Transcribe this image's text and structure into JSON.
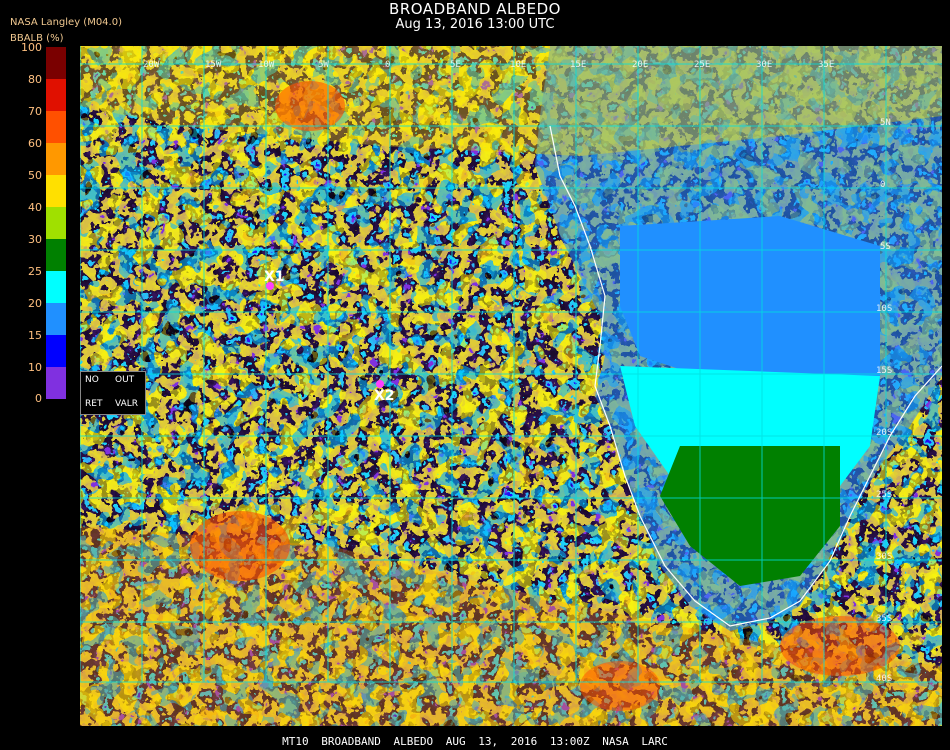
{
  "header": {
    "title": "BROADBAND ALBEDO",
    "subtitle": "Aug 13, 2016 13:00 UTC",
    "brand": "NASA Langley (M04.0)",
    "unit": "BBALB (%)"
  },
  "colorbar": {
    "stops": [
      {
        "label": "100",
        "color": "#7a0000"
      },
      {
        "label": "80",
        "color": "#e01000"
      },
      {
        "label": "70",
        "color": "#ff5000"
      },
      {
        "label": "60",
        "color": "#ff9800"
      },
      {
        "label": "50",
        "color": "#ffe000"
      },
      {
        "label": "40",
        "color": "#a0e000"
      },
      {
        "label": "30",
        "color": "#008000"
      },
      {
        "label": "25",
        "color": "#00ffff"
      },
      {
        "label": "20",
        "color": "#2090ff"
      },
      {
        "label": "15",
        "color": "#0000ff"
      },
      {
        "label": "10",
        "color": "#8030e0"
      },
      {
        "label": "0",
        "color": ""
      }
    ]
  },
  "legend_box": {
    "no": "NO",
    "out": "OUT",
    "ret": "RET",
    "valr": "VALR"
  },
  "markers": {
    "x1": "X1",
    "x2": "X2"
  },
  "grid_labels": {
    "top": [
      "20W",
      "15W",
      "10W",
      "5W",
      "0",
      "5E",
      "10E",
      "15E",
      "20E",
      "25E",
      "30E",
      "35E"
    ],
    "right": [
      "5N",
      "0",
      "5S",
      "10S",
      "15S",
      "20S",
      "25S",
      "30S",
      "35S",
      "40S"
    ]
  },
  "footer": "MT10  BROADBAND ALBEDO   AUG 13, 2016 13:00Z   NASA LARC"
}
